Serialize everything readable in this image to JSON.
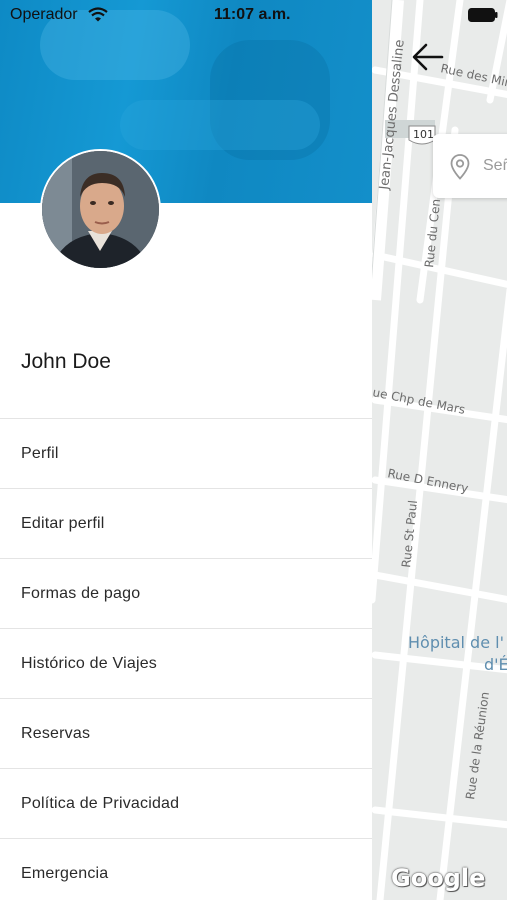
{
  "status_bar": {
    "carrier": "Operador",
    "time": "11:07 a.m."
  },
  "drawer": {
    "user_name": "John Doe",
    "menu_items": [
      {
        "label": "Perfil"
      },
      {
        "label": "Editar perfil"
      },
      {
        "label": "Formas de pago"
      },
      {
        "label": "Histórico de Viajes"
      },
      {
        "label": "Reservas"
      },
      {
        "label": "Política de Privacidad"
      },
      {
        "label": "Emergencia"
      }
    ]
  },
  "map": {
    "search_placeholder": "Señ",
    "highway_shield": "101",
    "streets": {
      "jean_jacques": "Jean-Jacques Dessaline",
      "rue_des_mi": "Rue des Mir",
      "rue_du_cen": "Rue du Cen",
      "rue_chp_de_mars": "ue Chp de Mars",
      "rue_d_ennery": "Rue D Ennery",
      "rue_st_paul": "Rue St Paul",
      "rue_reunion": "Rue de la Réunion",
      "hopital_line1": "Hôpital de l'",
      "hopital_line2": "d'É"
    },
    "attribution": "Google"
  },
  "colors": {
    "header_blue": "#1196d2",
    "map_background": "#e9ebea",
    "poi_blue": "#5f8eaf"
  },
  "icons": {
    "back": "arrow-left-icon",
    "pin": "location-pin-icon",
    "wifi": "wifi-icon",
    "battery": "battery-icon"
  }
}
